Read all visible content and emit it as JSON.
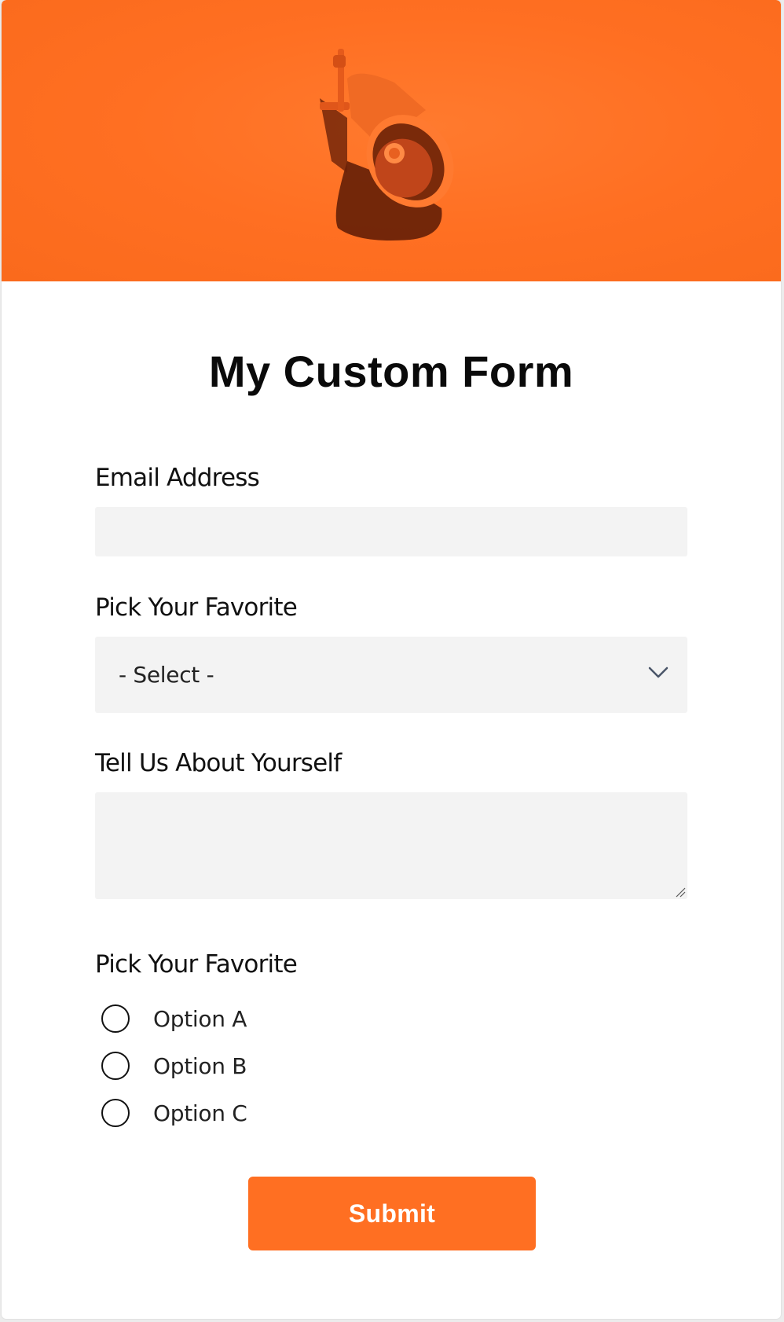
{
  "form": {
    "title": "My Custom Form",
    "email": {
      "label": "Email Address",
      "value": "",
      "placeholder": ""
    },
    "select": {
      "label": "Pick Your Favorite",
      "value": "- Select -"
    },
    "about": {
      "label": "Tell Us About Yourself",
      "value": "",
      "placeholder": ""
    },
    "radio": {
      "label": "Pick Your Favorite",
      "options": [
        {
          "label": "Option A",
          "checked": false
        },
        {
          "label": "Option B",
          "checked": false
        },
        {
          "label": "Option C",
          "checked": false
        }
      ]
    },
    "submit_label": "Submit"
  },
  "colors": {
    "accent": "#ff6f22",
    "field_bg": "#f3f3f3",
    "text": "#111111"
  },
  "icons": {
    "hero": "megaphone-icon",
    "select": "chevron-down-icon",
    "textarea": "resize-handle-icon"
  }
}
